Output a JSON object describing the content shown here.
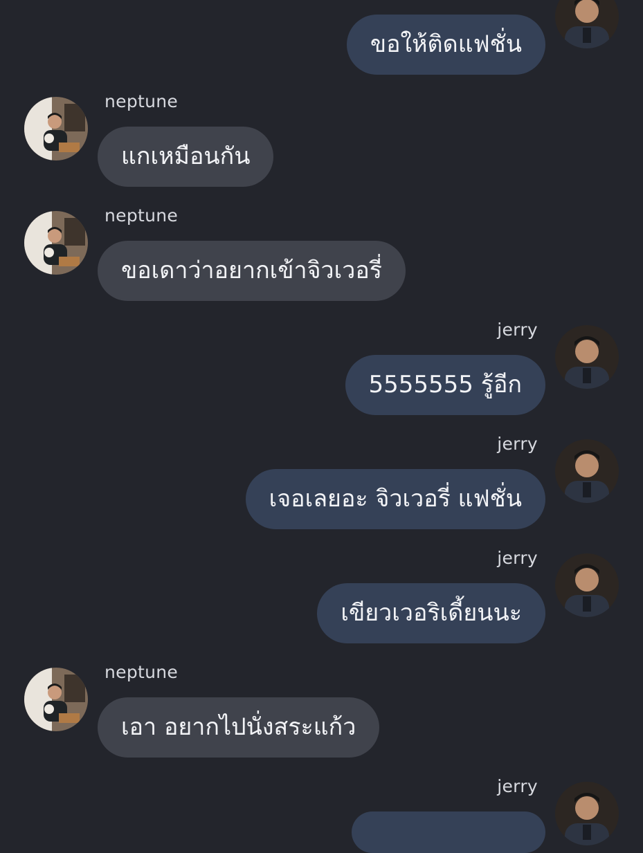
{
  "chat": {
    "messages": [
      {
        "side": "right",
        "sender": "jerry",
        "text": "ขอให้ติดแฟชั่น"
      },
      {
        "side": "left",
        "sender": "neptune",
        "text": "แกเหมือนกัน"
      },
      {
        "side": "left",
        "sender": "neptune",
        "text": "ขอเดาว่าอยากเข้าจิวเวอรี่"
      },
      {
        "side": "right",
        "sender": "jerry",
        "text": "5555555 รู้อีก"
      },
      {
        "side": "right",
        "sender": "jerry",
        "text": "เจอเลยอะ จิวเวอรี่ แฟชั่น"
      },
      {
        "side": "right",
        "sender": "jerry",
        "text": "เขียวเวอริเดี้ยนนะ"
      },
      {
        "side": "left",
        "sender": "neptune",
        "text": "เอา อยากไปนั่งสระแก้ว"
      },
      {
        "side": "right",
        "sender": "jerry",
        "text": ""
      }
    ]
  },
  "colors": {
    "background": "#23252c",
    "incoming_bubble": "#40434c",
    "outgoing_bubble": "#354157",
    "text": "#f2f3f6",
    "name": "#d7d9df"
  }
}
